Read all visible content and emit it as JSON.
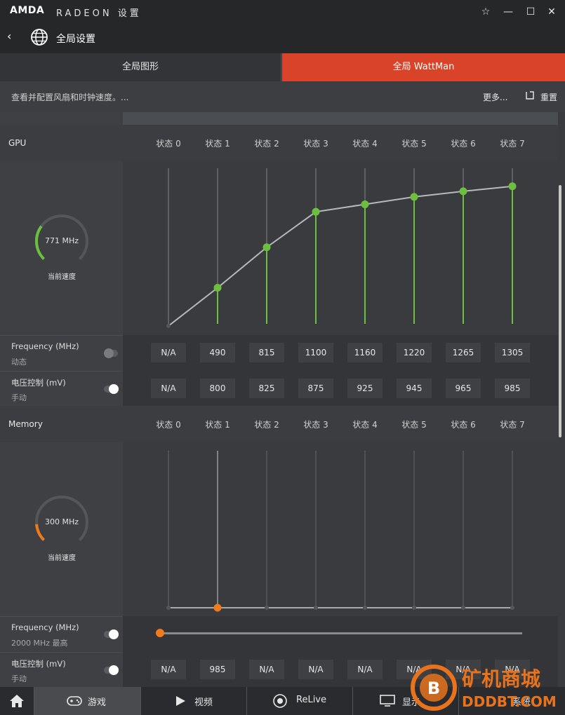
{
  "titlebar": {
    "logo": "AMDA",
    "brand": "RADEON 设置"
  },
  "nav": {
    "title": "全局设置"
  },
  "tabs": {
    "graphics": "全局图形",
    "wattman": "全局 WattMan"
  },
  "subbar": {
    "description": "查看并配置风扇和时钟速度。...",
    "more": "更多...",
    "reset": "重置"
  },
  "gpu": {
    "label": "GPU",
    "states": [
      "状态 0",
      "状态 1",
      "状态 2",
      "状态 3",
      "状态 4",
      "状态 5",
      "状态 6",
      "状态 7"
    ],
    "gauge_value": "771 MHz",
    "gauge_caption": "当前速度",
    "gauge_fraction": 0.3,
    "accent": "#6dbf3f",
    "frequency_title": "Frequency (MHz)",
    "frequency_mode": "动态",
    "frequency_values": [
      "N/A",
      "490",
      "815",
      "1100",
      "1160",
      "1220",
      "1265",
      "1305"
    ],
    "voltage_title": "电压控制 (mV)",
    "voltage_mode": "手动",
    "voltage_values": [
      "N/A",
      "800",
      "825",
      "875",
      "925",
      "945",
      "965",
      "985"
    ]
  },
  "memory": {
    "label": "Memory",
    "states": [
      "状态 0",
      "状态 1",
      "状态 2",
      "状态 3",
      "状态 4",
      "状态 5",
      "状态 6",
      "状态 7"
    ],
    "gauge_value": "300 MHz",
    "gauge_caption": "当前速度",
    "gauge_fraction": 0.15,
    "accent": "#f07a1c",
    "frequency_title": "Frequency (MHz)",
    "frequency_mode": "2000 MHz 最高",
    "frequency_slider_fraction": 0.0,
    "voltage_title": "电压控制 (mV)",
    "voltage_mode": "手动",
    "voltage_values": [
      "N/A",
      "985",
      "N/A",
      "N/A",
      "N/A",
      "N/A",
      "N/A",
      "N/A"
    ]
  },
  "bottom_tabs": {
    "games": "游戏",
    "video": "视频",
    "relive": "ReLive",
    "display": "显示",
    "system": "系统"
  },
  "watermark": {
    "line1": "矿机商城",
    "line2": "DDDBT.COM"
  }
}
